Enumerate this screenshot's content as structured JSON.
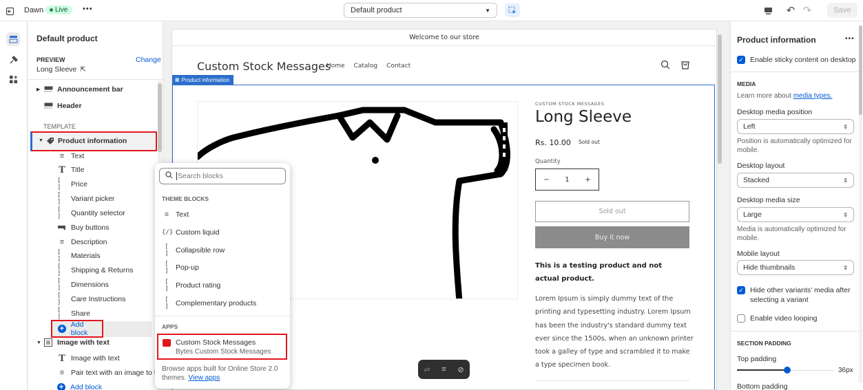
{
  "topbar": {
    "theme_name": "Dawn",
    "live_badge": "Live",
    "more": "•••",
    "template_select": "Default product",
    "save_label": "Save"
  },
  "left": {
    "title": "Default product",
    "preview_label": "PREVIEW",
    "change_label": "Change",
    "preview_product": "Long Sleeve",
    "sections": {
      "announcement": "Announcement bar",
      "header": "Header",
      "template_label": "TEMPLATE",
      "product_info": "Product information",
      "blocks": [
        "Text",
        "Title",
        "Price",
        "Variant picker",
        "Quantity selector",
        "Buy buttons",
        "Description",
        "Materials",
        "Shipping & Returns",
        "Dimensions",
        "Care Instructions",
        "Share"
      ],
      "add_block": "Add block",
      "image_with_text": "Image with text",
      "iwt_blocks": [
        "Image with text",
        "Pair text with an image to f..."
      ],
      "add_block2": "Add block"
    }
  },
  "popup": {
    "search_placeholder": "Search blocks",
    "theme_blocks_label": "THEME BLOCKS",
    "theme_blocks": [
      "Text",
      "Custom liquid",
      "Collapsible row",
      "Pop-up",
      "Product rating",
      "Complementary products"
    ],
    "apps_label": "APPS",
    "app_name": "Custom Stock Messages",
    "app_sub": "Bytes Custom Stock Messages",
    "footer_text": "Browse apps built for Online Store 2.0 themes.",
    "footer_link": "View apps"
  },
  "preview": {
    "announcement": "Welcome to our store",
    "store_name": "Custom Stock Messages",
    "nav": [
      "Home",
      "Catalog",
      "Contact"
    ],
    "section_tag": "Product information",
    "vendor": "CUSTOM STOCK MESSAGES",
    "product_title": "Long Sleeve",
    "price": "Rs. 10.00",
    "sold_out_badge": "Sold out",
    "quantity_label": "Quantity",
    "quantity_value": "1",
    "minus": "−",
    "plus": "+",
    "sold_out_button": "Sold out",
    "buy_now": "Buy it now",
    "bold_desc": "This is a testing product and not actual product.",
    "desc": "Lorem Ipsum is simply dummy text of the printing and typesetting industry. Lorem Ipsum has been the industry's standard dummy text ever since the 1500s, when an unknown printer took a galley of type and scrambled it to make a type specimen book."
  },
  "right": {
    "title": "Product information",
    "more": "•••",
    "sticky": "Enable sticky content on desktop",
    "media_label": "MEDIA",
    "media_learn_pre": "Learn more about ",
    "media_learn_link": "media types.",
    "desktop_media_position_label": "Desktop media position",
    "desktop_media_position": "Left",
    "position_hint": "Position is automatically optimized for mobile.",
    "desktop_layout_label": "Desktop layout",
    "desktop_layout": "Stacked",
    "desktop_media_size_label": "Desktop media size",
    "desktop_media_size": "Large",
    "media_hint": "Media is automatically optimized for mobile.",
    "mobile_layout_label": "Mobile layout",
    "mobile_layout": "Hide thumbnails",
    "hide_variants": "Hide other variants' media after selecting a variant",
    "video_looping": "Enable video looping",
    "section_padding_label": "SECTION PADDING",
    "top_padding_label": "Top padding",
    "top_padding_value": "36px",
    "top_padding_fraction": 0.36,
    "bottom_padding_label": "Bottom padding"
  }
}
